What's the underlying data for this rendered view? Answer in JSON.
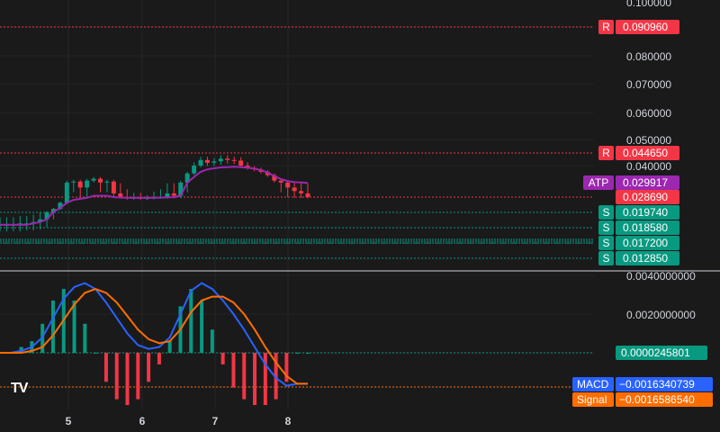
{
  "logo": "TV",
  "chart_data": {
    "type": "candlestick",
    "x_ticks": [
      "5",
      "6",
      "7",
      "8"
    ],
    "price_pane": {
      "y_ticks": [
        "0.100000",
        "0.080000",
        "0.070000",
        "0.060000",
        "0.050000",
        "0.040000"
      ],
      "ylim": [
        0.014,
        0.102
      ],
      "scale": "log",
      "resistance_levels": [
        {
          "tag": "R",
          "value": "0.090960",
          "color": "#f23645"
        },
        {
          "tag": "R",
          "value": "0.044650",
          "color": "#f23645"
        }
      ],
      "atp": {
        "tag": "ATP",
        "value": "0.029917",
        "color": "#9c27b0"
      },
      "last_price": {
        "value": "0.028690",
        "color": "#f23645"
      },
      "support_levels": [
        {
          "tag": "S",
          "value": "0.019740",
          "color": "#089981"
        },
        {
          "tag": "S",
          "value": "0.018580",
          "color": "#089981"
        },
        {
          "tag": "S",
          "value": "0.017200",
          "color": "#089981"
        },
        {
          "tag": "S",
          "value": "0.012850",
          "color": "#089981"
        }
      ],
      "close_series": [
        0.0188,
        0.0188,
        0.0188,
        0.0189,
        0.0189,
        0.019,
        0.0192,
        0.0198,
        0.0215,
        0.025,
        0.03,
        0.0305,
        0.0295,
        0.031,
        0.032,
        0.03,
        0.0305,
        0.029,
        0.0285,
        0.0278,
        0.0282,
        0.0276,
        0.028,
        0.0283,
        0.0285,
        0.029,
        0.0288,
        0.03,
        0.035,
        0.04,
        0.042,
        0.041,
        0.0415,
        0.0425,
        0.042,
        0.0418,
        0.04,
        0.0385,
        0.0375,
        0.036,
        0.034,
        0.031,
        0.03,
        0.0295,
        0.0292,
        0.029,
        0.0287
      ],
      "atp_series": [
        0.0188,
        0.0188,
        0.0188,
        0.0188,
        0.0188,
        0.0189,
        0.019,
        0.0192,
        0.02,
        0.022,
        0.025,
        0.0268,
        0.0275,
        0.0282,
        0.0288,
        0.0288,
        0.0288,
        0.0286,
        0.0284,
        0.0282,
        0.0282,
        0.0281,
        0.0281,
        0.0282,
        0.0283,
        0.0285,
        0.0286,
        0.0288,
        0.03,
        0.033,
        0.036,
        0.0375,
        0.0382,
        0.0388,
        0.039,
        0.0392,
        0.039,
        0.0386,
        0.038,
        0.037,
        0.0355,
        0.0335,
        0.0318,
        0.0308,
        0.0302,
        0.03,
        0.0299
      ]
    },
    "macd_pane": {
      "y_ticks": [
        "0.0040000000",
        "0.0020000000"
      ],
      "histogram_label": {
        "value": "0.0000245801",
        "color": "#089981"
      },
      "macd": {
        "name": "MACD",
        "value": "−0.0016340739",
        "color": "#2962ff"
      },
      "signal": {
        "name": "Signal",
        "value": "−0.0016586540",
        "color": "#ff6d00"
      },
      "macd_series": [
        0.0,
        0.0,
        0.0001,
        0.0003,
        0.0008,
        0.0018,
        0.0028,
        0.0034,
        0.0036,
        0.0033,
        0.0026,
        0.0018,
        0.001,
        0.0004,
        0.0002,
        0.0003,
        0.0008,
        0.002,
        0.0032,
        0.0036,
        0.0033,
        0.0027,
        0.002,
        0.0012,
        0.0003,
        -0.0006,
        -0.0013,
        -0.0017,
        -0.0016,
        -0.0016
      ],
      "signal_series": [
        0.0,
        0.0,
        0.0,
        0.0001,
        0.0003,
        0.0009,
        0.0017,
        0.0025,
        0.0031,
        0.0033,
        0.0031,
        0.0026,
        0.0019,
        0.0012,
        0.0007,
        0.0005,
        0.0006,
        0.0012,
        0.0021,
        0.0027,
        0.0029,
        0.0029,
        0.0026,
        0.002,
        0.0012,
        0.0003,
        -0.0005,
        -0.0012,
        -0.0016,
        -0.0016
      ]
    }
  }
}
